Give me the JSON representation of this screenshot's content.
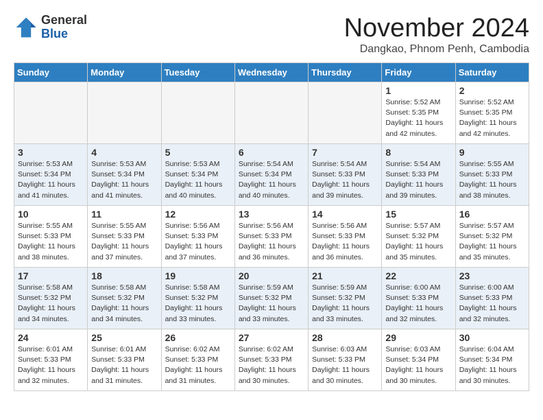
{
  "header": {
    "logo": {
      "general": "General",
      "blue": "Blue"
    },
    "title": "November 2024",
    "subtitle": "Dangkao, Phnom Penh, Cambodia"
  },
  "weekdays": [
    "Sunday",
    "Monday",
    "Tuesday",
    "Wednesday",
    "Thursday",
    "Friday",
    "Saturday"
  ],
  "weeks": [
    [
      {
        "day": null,
        "info": null
      },
      {
        "day": null,
        "info": null
      },
      {
        "day": null,
        "info": null
      },
      {
        "day": null,
        "info": null
      },
      {
        "day": null,
        "info": null
      },
      {
        "day": "1",
        "info": "Sunrise: 5:52 AM\nSunset: 5:35 PM\nDaylight: 11 hours\nand 42 minutes."
      },
      {
        "day": "2",
        "info": "Sunrise: 5:52 AM\nSunset: 5:35 PM\nDaylight: 11 hours\nand 42 minutes."
      }
    ],
    [
      {
        "day": "3",
        "info": "Sunrise: 5:53 AM\nSunset: 5:34 PM\nDaylight: 11 hours\nand 41 minutes."
      },
      {
        "day": "4",
        "info": "Sunrise: 5:53 AM\nSunset: 5:34 PM\nDaylight: 11 hours\nand 41 minutes."
      },
      {
        "day": "5",
        "info": "Sunrise: 5:53 AM\nSunset: 5:34 PM\nDaylight: 11 hours\nand 40 minutes."
      },
      {
        "day": "6",
        "info": "Sunrise: 5:54 AM\nSunset: 5:34 PM\nDaylight: 11 hours\nand 40 minutes."
      },
      {
        "day": "7",
        "info": "Sunrise: 5:54 AM\nSunset: 5:33 PM\nDaylight: 11 hours\nand 39 minutes."
      },
      {
        "day": "8",
        "info": "Sunrise: 5:54 AM\nSunset: 5:33 PM\nDaylight: 11 hours\nand 39 minutes."
      },
      {
        "day": "9",
        "info": "Sunrise: 5:55 AM\nSunset: 5:33 PM\nDaylight: 11 hours\nand 38 minutes."
      }
    ],
    [
      {
        "day": "10",
        "info": "Sunrise: 5:55 AM\nSunset: 5:33 PM\nDaylight: 11 hours\nand 38 minutes."
      },
      {
        "day": "11",
        "info": "Sunrise: 5:55 AM\nSunset: 5:33 PM\nDaylight: 11 hours\nand 37 minutes."
      },
      {
        "day": "12",
        "info": "Sunrise: 5:56 AM\nSunset: 5:33 PM\nDaylight: 11 hours\nand 37 minutes."
      },
      {
        "day": "13",
        "info": "Sunrise: 5:56 AM\nSunset: 5:33 PM\nDaylight: 11 hours\nand 36 minutes."
      },
      {
        "day": "14",
        "info": "Sunrise: 5:56 AM\nSunset: 5:33 PM\nDaylight: 11 hours\nand 36 minutes."
      },
      {
        "day": "15",
        "info": "Sunrise: 5:57 AM\nSunset: 5:32 PM\nDaylight: 11 hours\nand 35 minutes."
      },
      {
        "day": "16",
        "info": "Sunrise: 5:57 AM\nSunset: 5:32 PM\nDaylight: 11 hours\nand 35 minutes."
      }
    ],
    [
      {
        "day": "17",
        "info": "Sunrise: 5:58 AM\nSunset: 5:32 PM\nDaylight: 11 hours\nand 34 minutes."
      },
      {
        "day": "18",
        "info": "Sunrise: 5:58 AM\nSunset: 5:32 PM\nDaylight: 11 hours\nand 34 minutes."
      },
      {
        "day": "19",
        "info": "Sunrise: 5:58 AM\nSunset: 5:32 PM\nDaylight: 11 hours\nand 33 minutes."
      },
      {
        "day": "20",
        "info": "Sunrise: 5:59 AM\nSunset: 5:32 PM\nDaylight: 11 hours\nand 33 minutes."
      },
      {
        "day": "21",
        "info": "Sunrise: 5:59 AM\nSunset: 5:32 PM\nDaylight: 11 hours\nand 33 minutes."
      },
      {
        "day": "22",
        "info": "Sunrise: 6:00 AM\nSunset: 5:33 PM\nDaylight: 11 hours\nand 32 minutes."
      },
      {
        "day": "23",
        "info": "Sunrise: 6:00 AM\nSunset: 5:33 PM\nDaylight: 11 hours\nand 32 minutes."
      }
    ],
    [
      {
        "day": "24",
        "info": "Sunrise: 6:01 AM\nSunset: 5:33 PM\nDaylight: 11 hours\nand 32 minutes."
      },
      {
        "day": "25",
        "info": "Sunrise: 6:01 AM\nSunset: 5:33 PM\nDaylight: 11 hours\nand 31 minutes."
      },
      {
        "day": "26",
        "info": "Sunrise: 6:02 AM\nSunset: 5:33 PM\nDaylight: 11 hours\nand 31 minutes."
      },
      {
        "day": "27",
        "info": "Sunrise: 6:02 AM\nSunset: 5:33 PM\nDaylight: 11 hours\nand 30 minutes."
      },
      {
        "day": "28",
        "info": "Sunrise: 6:03 AM\nSunset: 5:33 PM\nDaylight: 11 hours\nand 30 minutes."
      },
      {
        "day": "29",
        "info": "Sunrise: 6:03 AM\nSunset: 5:34 PM\nDaylight: 11 hours\nand 30 minutes."
      },
      {
        "day": "30",
        "info": "Sunrise: 6:04 AM\nSunset: 5:34 PM\nDaylight: 11 hours\nand 30 minutes."
      }
    ]
  ]
}
